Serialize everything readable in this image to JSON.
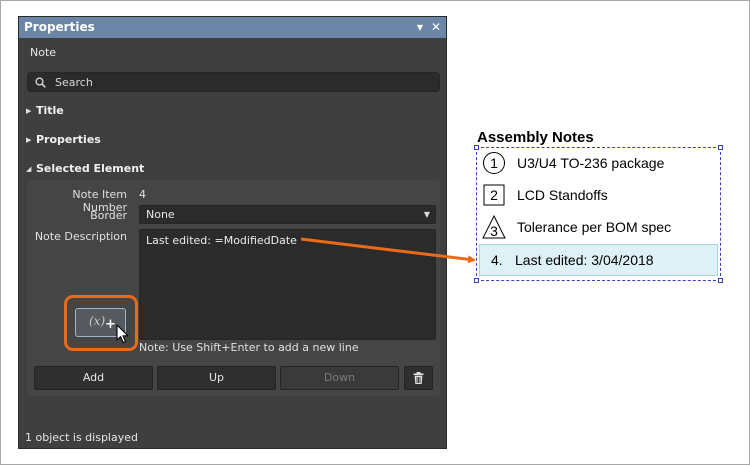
{
  "panel": {
    "title": "Properties",
    "subtitle": "Note",
    "search_placeholder": "Search",
    "sections": {
      "title": "Title",
      "properties": "Properties",
      "selected": "Selected Element"
    },
    "fields": {
      "item_number_label": "Note Item Number",
      "item_number_value": "4",
      "border_label": "Border",
      "border_value": "None",
      "description_label": "Note Description",
      "description_value": "Last edited: =ModifiedDate"
    },
    "insert_button_label": "(x)",
    "hint": "Note: Use Shift+Enter to add a new line",
    "buttons": {
      "add": "Add",
      "up": "Up",
      "down": "Down"
    },
    "status": "1 object is displayed"
  },
  "assembly": {
    "title": "Assembly Notes",
    "notes": [
      {
        "num": "1",
        "symbol": "circle",
        "text": "U3/U4 TO-236 package"
      },
      {
        "num": "2",
        "symbol": "square",
        "text": "LCD Standoffs"
      },
      {
        "num": "3",
        "symbol": "triangle",
        "text": "Tolerance per BOM spec"
      },
      {
        "num": "4.",
        "symbol": "none",
        "text": "Last edited: 3/04/2018"
      }
    ]
  },
  "colors": {
    "header": "#6b86a7",
    "panel": "#3f3f3f",
    "highlight": "#ea6a18",
    "selection": "#3d3dc4",
    "selected_row": "#ddf1f6"
  }
}
